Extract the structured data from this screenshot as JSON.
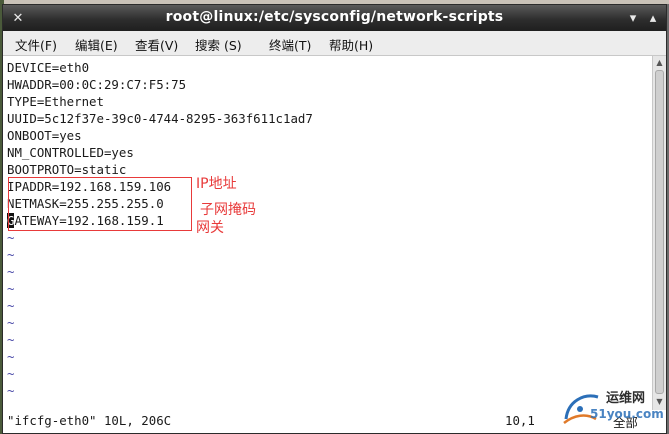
{
  "window": {
    "title": "root@linux:/etc/sysconfig/network-scripts"
  },
  "menu": {
    "items": [
      {
        "label": "文件(F)"
      },
      {
        "label": "编辑(E)"
      },
      {
        "label": "查看(V)"
      },
      {
        "label": "搜索 (S)"
      },
      {
        "label": "终端(T)"
      },
      {
        "label": "帮助(H)"
      }
    ]
  },
  "editor": {
    "lines": [
      "DEVICE=eth0",
      "HWADDR=00:0C:29:C7:F5:75",
      "TYPE=Ethernet",
      "UUID=5c12f37e-39c0-4744-8295-363f611c1ad7",
      "ONBOOT=yes",
      "NM_CONTROLLED=yes",
      "BOOTPROTO=static",
      "IPADDR=192.168.159.106",
      "NETMASK=255.255.255.0",
      "ATEWAY=192.168.159.1"
    ],
    "cursor_char": "G",
    "tilde": "~"
  },
  "annotations": {
    "ip": "IP地址",
    "netmask": "子网掩码",
    "gateway": "网关",
    "color": "#e83a3a"
  },
  "status": {
    "file_info": "\"ifcfg-eth0\" 10L, 206C",
    "position": "10,1",
    "scroll": "全部"
  },
  "watermark": {
    "site": "运维网",
    "url": "51you.com"
  }
}
